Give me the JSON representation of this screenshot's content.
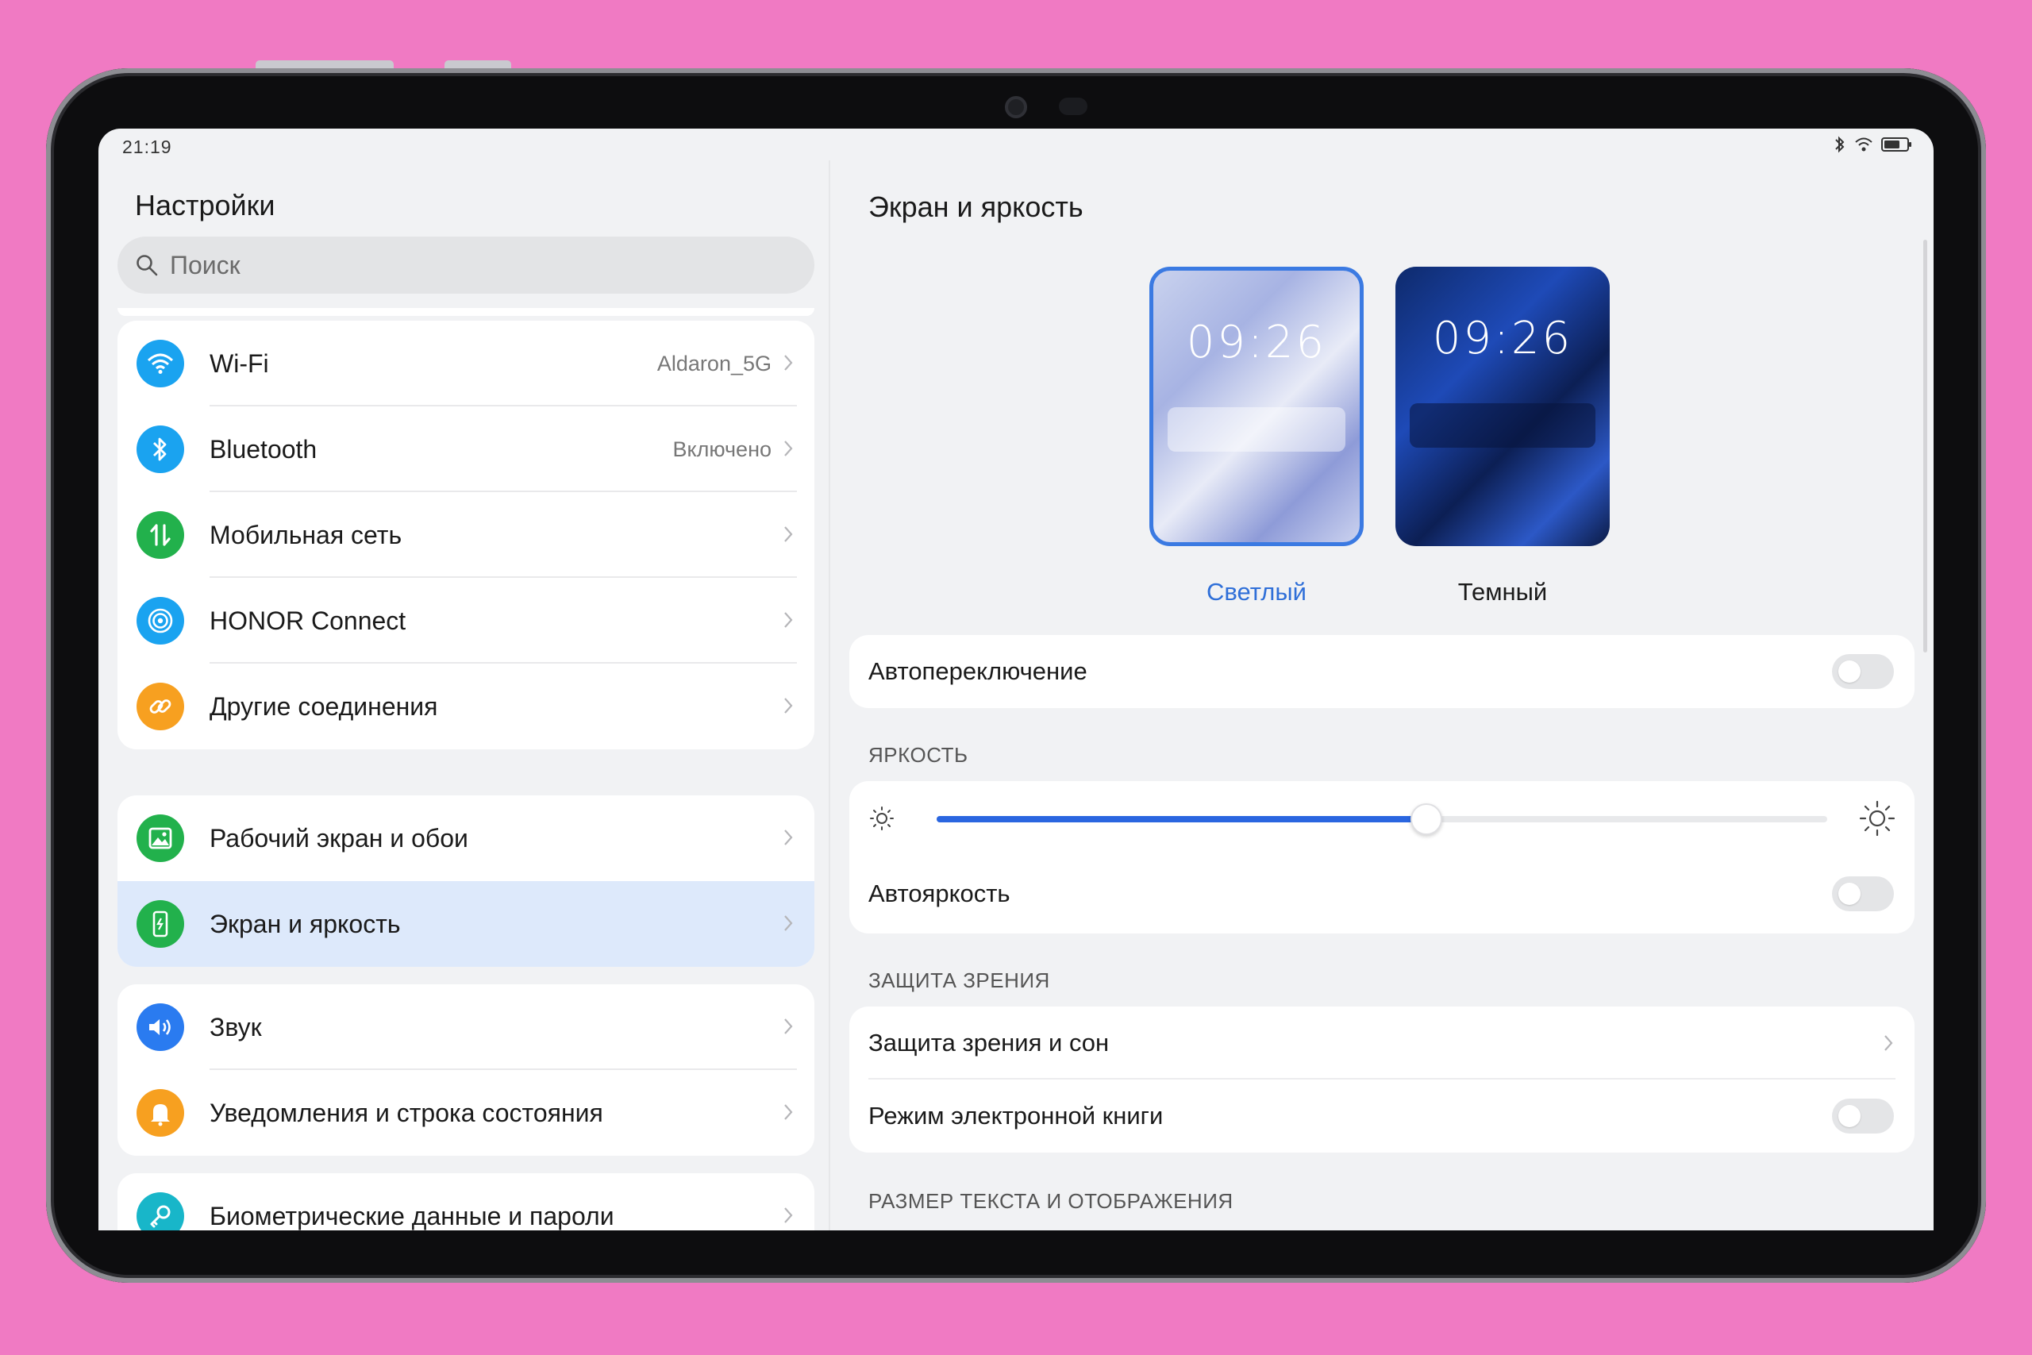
{
  "status_bar": {
    "time": "21:19"
  },
  "left": {
    "title": "Настройки",
    "search_placeholder": "Поиск",
    "groups": [
      [
        {
          "label": "Wi-Fi",
          "value": "Aldaron_5G",
          "icon": "wifi-icon",
          "color": "#1aa3f0"
        },
        {
          "label": "Bluetooth",
          "value": "Включено",
          "icon": "bluetooth-icon",
          "color": "#1aa3f0"
        },
        {
          "label": "Мобильная сеть",
          "value": "",
          "icon": "mobile-data-icon",
          "color": "#22b14c"
        },
        {
          "label": "HONOR Connect",
          "value": "",
          "icon": "honor-connect-icon",
          "color": "#1aa3f0"
        },
        {
          "label": "Другие соединения",
          "value": "",
          "icon": "link-icon",
          "color": "#f7a020"
        }
      ],
      [
        {
          "label": "Рабочий экран и обои",
          "value": "",
          "icon": "wallpaper-icon",
          "color": "#22b14c"
        },
        {
          "label": "Экран и яркость",
          "value": "",
          "icon": "display-icon",
          "color": "#22b14c",
          "active": true
        }
      ],
      [
        {
          "label": "Звук",
          "value": "",
          "icon": "sound-icon",
          "color": "#2a7bf0"
        },
        {
          "label": "Уведомления и строка состояния",
          "value": "",
          "icon": "bell-icon",
          "color": "#f7a020"
        }
      ],
      [
        {
          "label": "Биометрические данные и пароли",
          "value": "",
          "icon": "key-icon",
          "color": "#18b6c9"
        }
      ]
    ]
  },
  "right": {
    "title": "Экран и яркость",
    "themes": [
      {
        "label": "Светлый",
        "clock": "09:26",
        "selected": true
      },
      {
        "label": "Темный",
        "clock": "09:26",
        "selected": false
      }
    ],
    "auto_switch_label": "Автопереключение",
    "brightness_section": "ЯРКОСТЬ",
    "brightness_level": 0.55,
    "auto_brightness_label": "Автояркость",
    "eye_section": "ЗАЩИТА ЗРЕНИЯ",
    "eye_sleep_label": "Защита зрения и сон",
    "ebook_label": "Режим электронной книги",
    "text_size_section": "РАЗМЕР ТЕКСТА И ОТОБРАЖЕНИЯ"
  },
  "colors": {
    "accent": "#2a66e0",
    "selected_border": "#3b7ae2",
    "active_row": "#dde9fb"
  }
}
